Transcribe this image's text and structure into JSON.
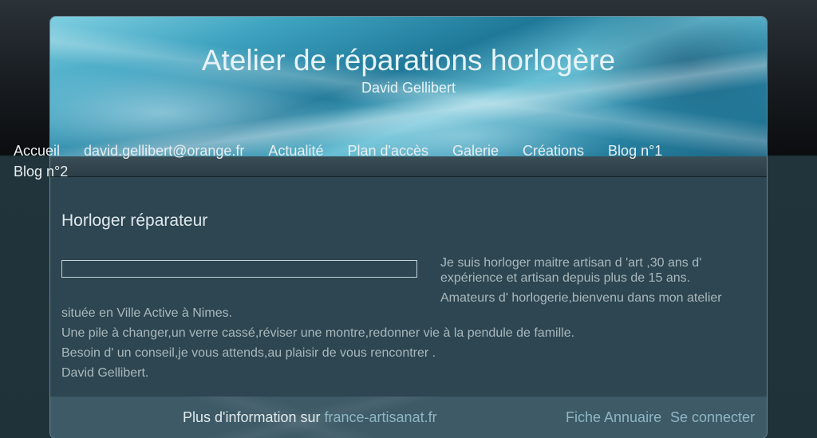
{
  "header": {
    "title": "Atelier de réparations horlogère",
    "subtitle": "David Gellibert"
  },
  "nav": {
    "items": [
      "Accueil",
      "david.gellibert@orange.fr",
      "Actualité",
      "Plan d'accès",
      "Galerie",
      "Créations",
      "Blog n°1",
      "Blog n°2"
    ]
  },
  "content": {
    "title": "Horloger réparateur",
    "side_text": [
      "Je suis horloger maitre artisan d 'art ,30 ans d'",
      "expérience et artisan depuis plus de 15 ans.",
      "Amateurs d' horlogerie,bienvenu dans mon atelier"
    ],
    "body_text": [
      "située en Ville Active à Nimes.",
      "Une pile à changer,un verre cassé,réviser une montre,redonner vie à la pendule de famille.",
      "Besoin d' un conseil,je vous attends,au plaisir de vous rencontrer .",
      "David Gellibert."
    ]
  },
  "footer": {
    "info_prefix": "Plus d'information sur ",
    "info_link": "france-artisanat.fr",
    "fiche_annuaire": "Fiche Annuaire",
    "connect": "Se connecter"
  }
}
